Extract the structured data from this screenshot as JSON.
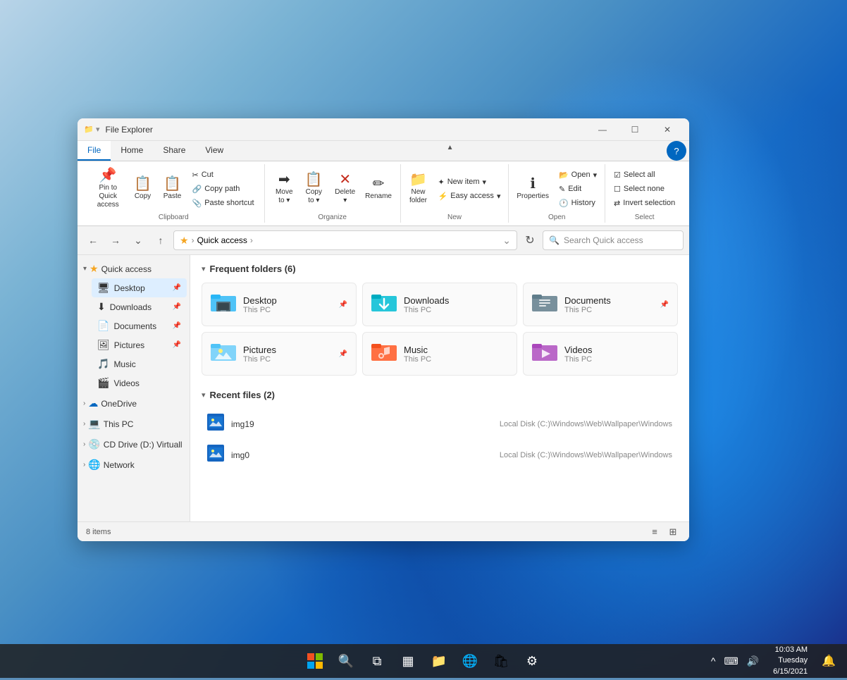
{
  "desktop": {
    "background": "windows11-bloom"
  },
  "taskbar": {
    "start_icon": "⊞",
    "search_icon": "🔍",
    "task_view_icon": "⧉",
    "widgets_icon": "▦",
    "file_explorer_icon": "📁",
    "edge_icon": "🌐",
    "store_icon": "🛍",
    "settings_icon": "⚙",
    "clock": {
      "time": "10:03 AM",
      "date_line1": "Tuesday",
      "date_line2": "6/15/2021"
    },
    "tray": {
      "chevron": "^",
      "keyboard": "⌨",
      "volume": "🔊",
      "notification": "🔔"
    }
  },
  "window": {
    "title": "File Explorer",
    "title_icon": "📁",
    "controls": {
      "minimize": "—",
      "maximize": "☐",
      "close": "✕"
    }
  },
  "ribbon": {
    "tabs": [
      {
        "label": "File",
        "active": true
      },
      {
        "label": "Home",
        "active": false
      },
      {
        "label": "Share",
        "active": false
      },
      {
        "label": "View",
        "active": false
      }
    ],
    "clipboard": {
      "label": "Clipboard",
      "pin_to_quick": "Pin to Quick\naccess",
      "copy": "Copy",
      "paste": "Paste",
      "cut": "Cut",
      "copy_path": "Copy path",
      "paste_shortcut": "Paste shortcut"
    },
    "organize": {
      "label": "Organize",
      "move_to": "Move\nto",
      "copy_to": "Copy\nto",
      "delete": "Delete",
      "rename": "Rename"
    },
    "new_group": {
      "label": "New",
      "new_item": "New item",
      "easy_access": "Easy access",
      "new_folder": "New\nfolder"
    },
    "open_group": {
      "label": "Open",
      "properties": "Properties",
      "open": "Open",
      "edit": "Edit",
      "history": "History"
    },
    "select_group": {
      "label": "Select",
      "select_all": "Select all",
      "select_none": "Select none",
      "invert_selection": "Invert selection"
    }
  },
  "address_bar": {
    "back": "←",
    "forward": "→",
    "up_caret": "↑",
    "up": "↑",
    "star": "★",
    "path": "Quick access",
    "breadcrumb_separator": "›",
    "refresh": "↻",
    "search_placeholder": "Search Quick access"
  },
  "sidebar": {
    "quick_access": {
      "label": "Quick access",
      "expanded": true,
      "items": [
        {
          "label": "Desktop",
          "icon": "🖥",
          "pinned": true
        },
        {
          "label": "Downloads",
          "icon": "⬇",
          "pinned": true
        },
        {
          "label": "Documents",
          "icon": "📄",
          "pinned": true
        },
        {
          "label": "Pictures",
          "icon": "🖼",
          "pinned": true
        },
        {
          "label": "Music",
          "icon": "🎵",
          "pinned": false
        },
        {
          "label": "Videos",
          "icon": "🎬",
          "pinned": false
        }
      ]
    },
    "onedrive": {
      "label": "OneDrive",
      "icon": "☁",
      "expanded": false
    },
    "this_pc": {
      "label": "This PC",
      "icon": "💻",
      "expanded": false
    },
    "cd_drive": {
      "label": "CD Drive (D:) Virtuall",
      "icon": "💿",
      "expanded": false
    },
    "network": {
      "label": "Network",
      "icon": "🌐",
      "expanded": false
    }
  },
  "main": {
    "frequent_folders": {
      "section_label": "Frequent folders (6)",
      "folders": [
        {
          "name": "Desktop",
          "sub": "This PC",
          "pin": true,
          "color": "blue"
        },
        {
          "name": "Downloads",
          "sub": "This PC",
          "pin": false,
          "color": "teal"
        },
        {
          "name": "Documents",
          "sub": "This PC",
          "pin": true,
          "color": "blue-gray"
        },
        {
          "name": "Pictures",
          "sub": "This PC",
          "pin": true,
          "color": "sky"
        },
        {
          "name": "Music",
          "sub": "This PC",
          "pin": false,
          "color": "orange"
        },
        {
          "name": "Videos",
          "sub": "This PC",
          "pin": false,
          "color": "purple"
        }
      ]
    },
    "recent_files": {
      "section_label": "Recent files (2)",
      "files": [
        {
          "name": "img19",
          "path": "Local Disk (C:)\\Windows\\Web\\Wallpaper\\Windows",
          "icon": "🖼"
        },
        {
          "name": "img0",
          "path": "Local Disk (C:)\\Windows\\Web\\Wallpaper\\Windows",
          "icon": "🖼"
        }
      ]
    }
  },
  "status_bar": {
    "item_count": "8 items",
    "list_view_icon": "≡",
    "grid_view_icon": "⊞"
  }
}
